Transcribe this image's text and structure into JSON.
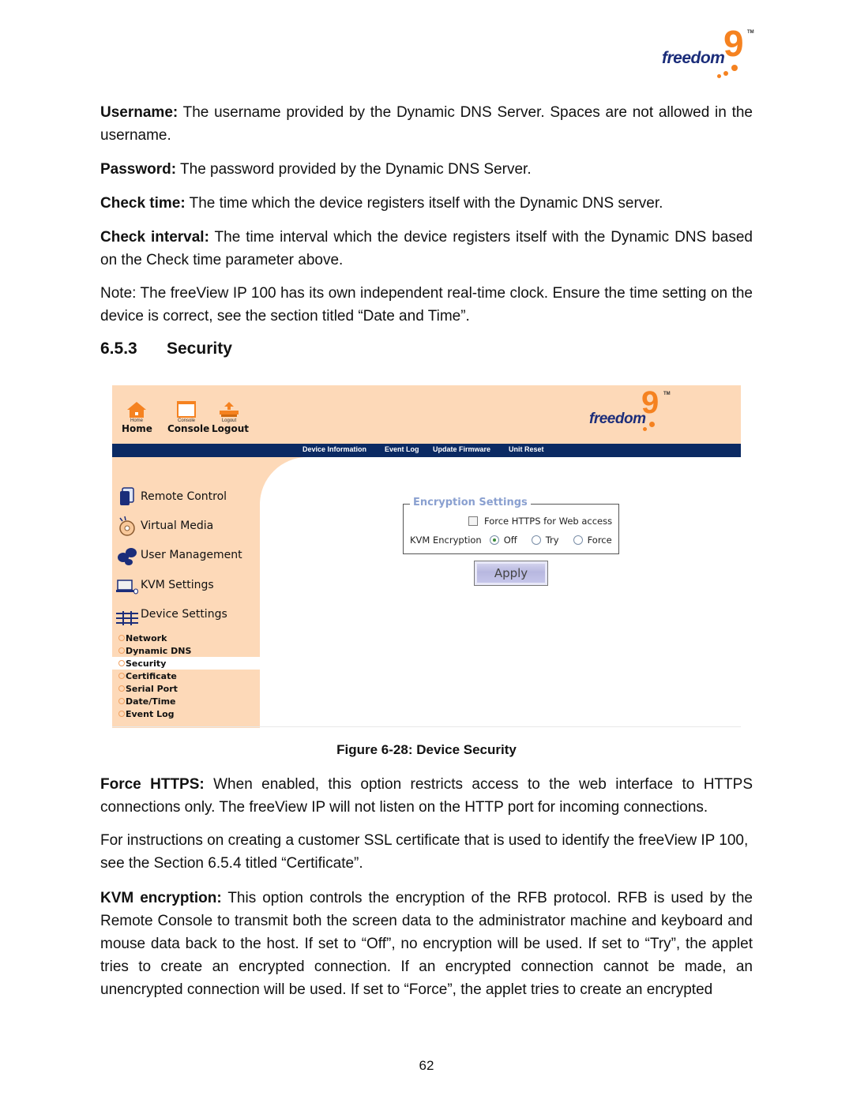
{
  "brand": {
    "logo_text": "freedom",
    "logo_nine": "9",
    "tm": "TM"
  },
  "paragraphs": {
    "username": {
      "term": "Username:",
      "text": " The username provided by the Dynamic DNS Server. Spaces are not allowed in the username."
    },
    "password": {
      "term": "Password:",
      "text": " The password provided by the Dynamic DNS Server."
    },
    "check_time": {
      "term": "Check time:",
      "text": " The time which the device registers itself with the Dynamic DNS server."
    },
    "check_interval": {
      "term": "Check interval:",
      "text": " The time interval which the device registers itself with the Dynamic DNS based on the Check time parameter above."
    },
    "note": {
      "text": "Note: The freeView IP 100 has its own independent real-time clock. Ensure the time setting on the device is correct, see the section titled “Date and Time”."
    },
    "force_https": {
      "term": "Force HTTPS:",
      "text": " When enabled, this option restricts access to the web interface to HTTPS connections only. The freeView IP will not listen on the HTTP port for incoming connections."
    },
    "ssl": {
      "text": "For instructions on creating a customer SSL certificate that is used to identify the freeView IP 100, see the Section 6.5.4 titled “Certificate”."
    },
    "kvm_encryption": {
      "term": "KVM encryption:",
      "text": " This option controls the encryption of the RFB protocol. RFB is used by the Remote Console to transmit both the screen data to the administrator machine and keyboard and mouse data back to the host. If set to “Off”, no encryption will be used. If set to “Try”, the applet tries to create an encrypted connection. If an encrypted connection cannot be made, an unencrypted connection will be used. If set to “Force”, the applet tries to create an encrypted"
    }
  },
  "section": {
    "number": "6.5.3",
    "title": "Security"
  },
  "figure": {
    "toolbar": [
      {
        "small": "Home",
        "label": "Home",
        "icon": "home-icon"
      },
      {
        "small": "Console",
        "label": "Console",
        "icon": "console-icon"
      },
      {
        "small": "Logout",
        "label": "Logout",
        "icon": "logout-icon"
      }
    ],
    "nav_links": [
      "Device Information",
      "Event Log",
      "Update Firmware",
      "Unit Reset"
    ],
    "menu": [
      {
        "label": "Remote Control",
        "icon": "remote-control-icon"
      },
      {
        "label": "Virtual Media",
        "icon": "virtual-media-icon"
      },
      {
        "label": "User Management",
        "icon": "user-management-icon"
      },
      {
        "label": "KVM Settings",
        "icon": "kvm-settings-icon"
      },
      {
        "label": "Device Settings",
        "icon": "device-settings-icon"
      }
    ],
    "submenu": [
      {
        "label": "Network",
        "active": false
      },
      {
        "label": "Dynamic DNS",
        "active": false
      },
      {
        "label": "Security",
        "active": true
      },
      {
        "label": "Certificate",
        "active": false
      },
      {
        "label": "Serial Port",
        "active": false
      },
      {
        "label": "Date/Time",
        "active": false
      },
      {
        "label": "Event Log",
        "active": false
      }
    ],
    "form": {
      "legend": "Encryption Settings",
      "force_https_label": "Force HTTPS for Web access",
      "force_https_checked": false,
      "kvm_label": "KVM Encryption",
      "kvm_options": [
        "Off",
        "Try",
        "Force"
      ],
      "kvm_selected": "Off",
      "apply_label": "Apply"
    },
    "colors": {
      "header_bg": "#fdd9b8",
      "nav_bg": "#0b2a63",
      "brand_orange": "#f58220",
      "brand_blue": "#1b2d7a",
      "legend": "#8aa0d0"
    }
  },
  "caption": "Figure 6-28: Device Security",
  "page_number": "62"
}
